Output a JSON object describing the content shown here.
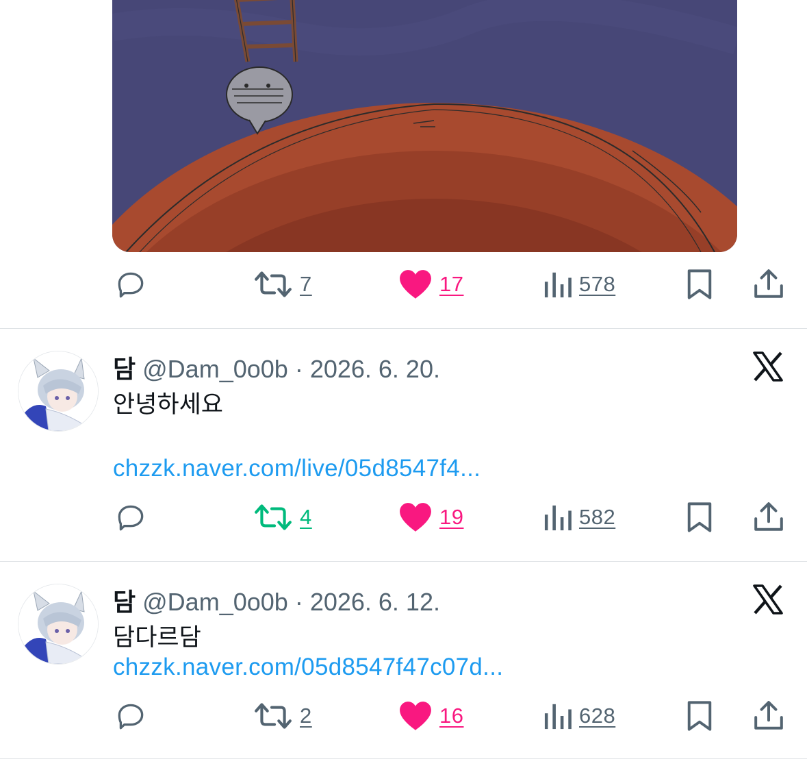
{
  "tweets": [
    {
      "counts": {
        "retweets": "7",
        "likes": "17",
        "views": "578"
      },
      "retweet_color": "#536471"
    },
    {
      "author": {
        "name": "담",
        "handle": "@Dam_0o0b",
        "separator": " · ",
        "date": "2026. 6. 20."
      },
      "text": "안녕하세요",
      "link": "chzzk.naver.com/live/05d8547f4...",
      "counts": {
        "retweets": "4",
        "likes": "19",
        "views": "582"
      },
      "retweet_color": "#00ba7c"
    },
    {
      "author": {
        "name": "담",
        "handle": "@Dam_0o0b",
        "separator": " · ",
        "date": "2026. 6. 12."
      },
      "text": "담다르담",
      "link": "chzzk.naver.com/05d8547f47c07d...",
      "counts": {
        "retweets": "2",
        "likes": "16",
        "views": "628"
      },
      "retweet_color": "#536471"
    }
  ],
  "colors": {
    "like": "#f91880",
    "link": "#1d9bf0",
    "icon": "#536471"
  },
  "icons": [
    "reply-icon",
    "retweet-icon",
    "heart-icon",
    "views-icon",
    "bookmark-icon",
    "share-icon",
    "x-logo-icon"
  ]
}
